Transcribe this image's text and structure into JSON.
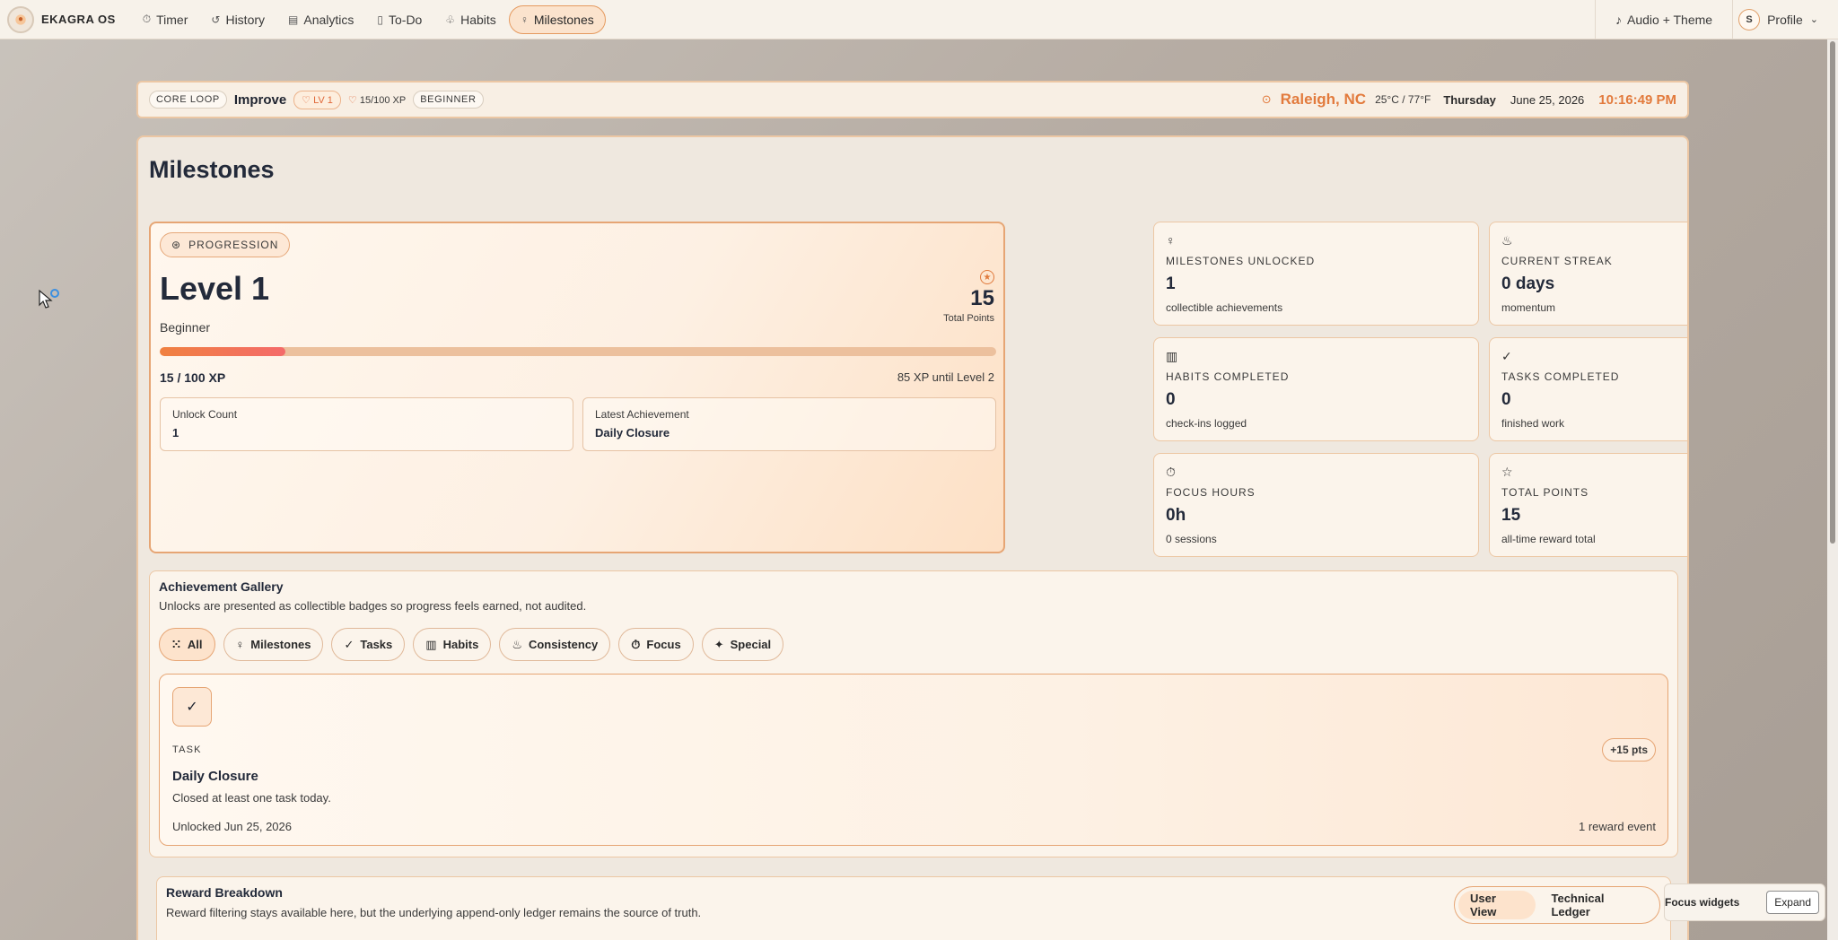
{
  "nav": {
    "brand": "EKAGRA OS",
    "items": [
      {
        "label": "Timer",
        "icon": "⏱",
        "active": false
      },
      {
        "label": "History",
        "icon": "↺",
        "active": false
      },
      {
        "label": "Analytics",
        "icon": "▤",
        "active": false
      },
      {
        "label": "To-Do",
        "icon": "▯",
        "active": false
      },
      {
        "label": "Habits",
        "icon": "♧",
        "active": false
      },
      {
        "label": "Milestones",
        "icon": "♀",
        "active": true
      }
    ],
    "audio_label": "Audio + Theme",
    "profile_initial": "S",
    "profile_label": "Profile"
  },
  "status": {
    "core_loop": "CORE LOOP",
    "improve": "Improve",
    "level": "LV 1",
    "xp": "15/100 XP",
    "rank": "BEGINNER",
    "city": "Raleigh, NC",
    "temp": "25°C / 77°F",
    "day": "Thursday",
    "date": "June 25, 2026",
    "time": "10:16:49 PM"
  },
  "page": {
    "title": "Milestones"
  },
  "progression": {
    "tag": "PROGRESSION",
    "level": "Level 1",
    "rank": "Beginner",
    "points": "15",
    "points_label": "Total Points",
    "xp_progress": 0.15,
    "xp_text": "15 / 100 XP",
    "xp_remaining": "85 XP until Level 2",
    "unlock_label": "Unlock Count",
    "unlock_value": "1",
    "latest_label": "Latest Achievement",
    "latest_value": "Daily Closure"
  },
  "stats": [
    {
      "icon": "♀",
      "label": "MILESTONES UNLOCKED",
      "value": "1",
      "sub": "collectible achievements"
    },
    {
      "icon": "♨",
      "label": "CURRENT STREAK",
      "value": "0 days",
      "sub": "momentum"
    },
    {
      "icon": "▥",
      "label": "HABITS COMPLETED",
      "value": "0",
      "sub": "check-ins logged"
    },
    {
      "icon": "✓",
      "label": "TASKS COMPLETED",
      "value": "0",
      "sub": "finished work"
    },
    {
      "icon": "⏱",
      "label": "FOCUS HOURS",
      "value": "0h",
      "sub": "0 sessions"
    },
    {
      "icon": "☆",
      "label": "TOTAL POINTS",
      "value": "15",
      "sub": "all-time reward total"
    }
  ],
  "gallery": {
    "title": "Achievement Gallery",
    "subtitle": "Unlocks are presented as collectible badges so progress feels earned, not audited.",
    "filters": [
      {
        "label": "All",
        "icon": "⁙",
        "active": true
      },
      {
        "label": "Milestones",
        "icon": "♀",
        "active": false
      },
      {
        "label": "Tasks",
        "icon": "✓",
        "active": false
      },
      {
        "label": "Habits",
        "icon": "▥",
        "active": false
      },
      {
        "label": "Consistency",
        "icon": "♨",
        "active": false
      },
      {
        "label": "Focus",
        "icon": "⏱",
        "active": false
      },
      {
        "label": "Special",
        "icon": "✦",
        "active": false
      }
    ],
    "achievement": {
      "type": "TASK",
      "points": "+15 pts",
      "name": "Daily Closure",
      "description": "Closed at least one task today.",
      "unlocked": "Unlocked Jun 25, 2026",
      "events": "1 reward event"
    }
  },
  "reward": {
    "title": "Reward Breakdown",
    "subtitle": "Reward filtering stays available here, but the underlying append-only ledger remains the source of truth.",
    "user_view": "User View",
    "technical_ledger": "Technical Ledger"
  },
  "focus_widget": {
    "label": "Focus widgets",
    "expand": "Expand"
  },
  "colors": {
    "accent": "#e27a3c",
    "border": "#ecc7a4",
    "panel": "#efe8df"
  }
}
